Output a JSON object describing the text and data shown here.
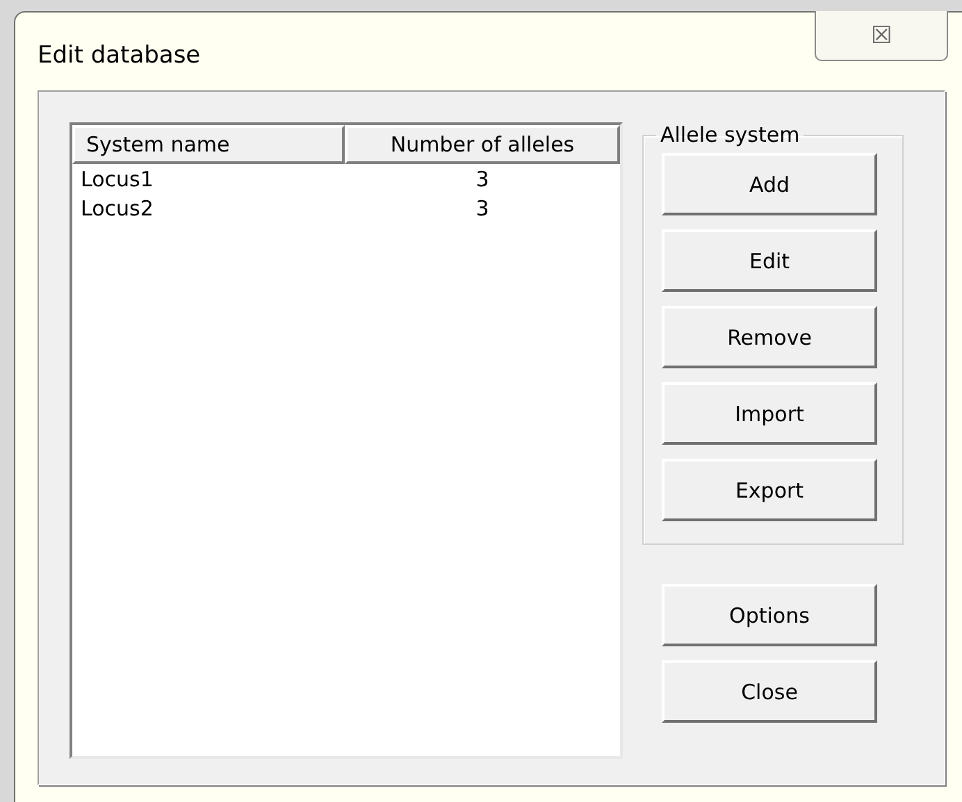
{
  "window": {
    "title": "Edit database",
    "close_glyph": "☒"
  },
  "table": {
    "columns": [
      "System name",
      "Number of alleles"
    ],
    "rows": [
      {
        "cells": [
          "Locus1",
          "3"
        ]
      },
      {
        "cells": [
          "Locus2",
          "3"
        ]
      }
    ]
  },
  "group": {
    "title": "Allele system",
    "buttons": [
      "Add",
      "Edit",
      "Remove",
      "Import",
      "Export"
    ]
  },
  "buttons": [
    "Options",
    "Close"
  ]
}
